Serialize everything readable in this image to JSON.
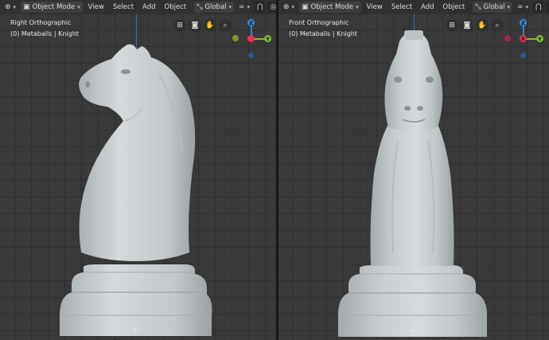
{
  "left_view": {
    "mode_label": "Object Mode",
    "menus": [
      "View",
      "Select",
      "Add",
      "Object"
    ],
    "orientation_label": "Global",
    "view_name": "Right Orthographic",
    "collection_info": "(0) Metaballs | Knight",
    "gizmo": {
      "top": "Z",
      "left": "",
      "right": "Y"
    }
  },
  "right_view": {
    "mode_label": "Object Mode",
    "menus": [
      "View",
      "Select",
      "Add",
      "Object"
    ],
    "orientation_label": "Global",
    "view_name": "Front Orthographic",
    "collection_info": "(0) Metaballs | Knight",
    "gizmo": {
      "top": "Z",
      "left": "X",
      "right": "Y"
    }
  },
  "icons": {
    "editor_type": "cube-cursor-icon",
    "mode": "object-mode-icon",
    "orientation": "transform-orientation-icon",
    "pivot": "link-icon",
    "snap": "magnet-icon",
    "proportional": "proportional-edit-icon",
    "grid": "grid-icon",
    "camera": "camera-icon",
    "pan": "hand-icon",
    "zoom": "zoom-icon"
  },
  "colors": {
    "x_axis": "#e8334a",
    "y_axis": "#7fbf32",
    "z_axis": "#2f86e4",
    "header_bg": "#303030",
    "viewport_bg": "#393939",
    "model": "#c4cacc"
  }
}
